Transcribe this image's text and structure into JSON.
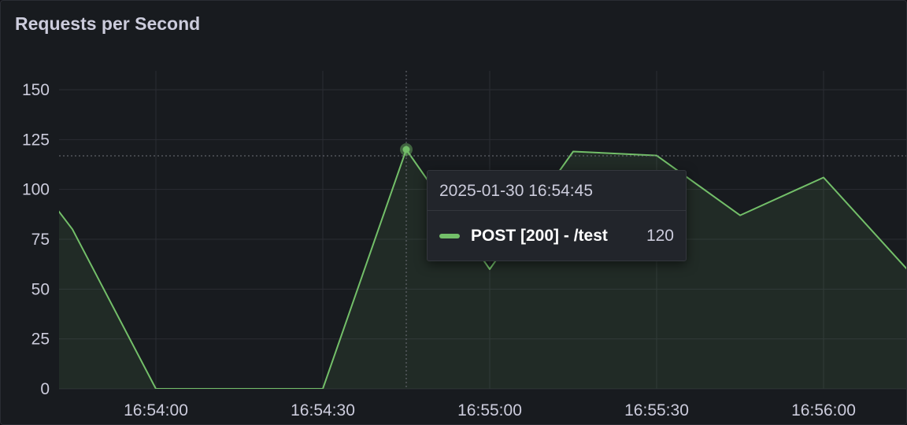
{
  "panel": {
    "title": "Requests per Second"
  },
  "colors": {
    "series": "#73bf69",
    "grid": "#2a2d33",
    "text": "#ccccdc",
    "background": "#181b1f"
  },
  "tooltip": {
    "time": "2025-01-30 16:54:45",
    "series": "POST [200] - /test",
    "value": "120"
  },
  "chart_data": {
    "type": "area",
    "title": "Requests per Second",
    "x_axis": {
      "type": "time",
      "ticks": [
        "16:54:00",
        "16:54:30",
        "16:55:00",
        "16:55:30",
        "16:56:00"
      ],
      "range": [
        "16:53:42",
        "16:56:15"
      ]
    },
    "y_axis": {
      "ticks": [
        0,
        25,
        50,
        75,
        100,
        125,
        150
      ],
      "range": [
        0,
        150
      ]
    },
    "grid": true,
    "series": [
      {
        "name": "POST [200] - /test",
        "points": [
          [
            "16:53:42",
            91
          ],
          [
            "16:53:45",
            80
          ],
          [
            "16:54:00",
            0
          ],
          [
            "16:54:15",
            0
          ],
          [
            "16:54:30",
            0
          ],
          [
            "16:54:45",
            120
          ],
          [
            "16:55:00",
            60
          ],
          [
            "16:55:15",
            119
          ],
          [
            "16:55:30",
            117
          ],
          [
            "16:55:45",
            87
          ],
          [
            "16:56:00",
            106
          ],
          [
            "16:56:15",
            60
          ]
        ]
      }
    ],
    "hover": {
      "x": "16:54:45",
      "y": 120
    }
  }
}
